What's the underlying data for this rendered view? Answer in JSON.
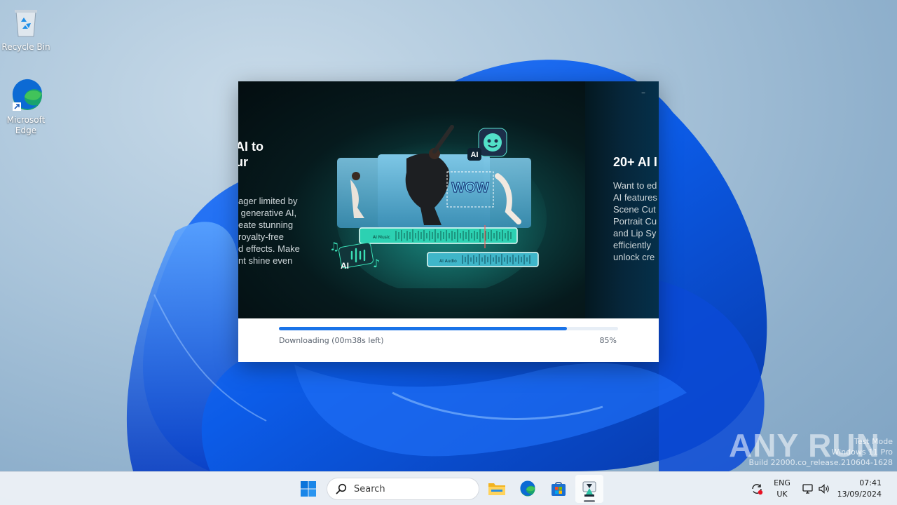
{
  "desktop": {
    "icons": [
      {
        "label": "Recycle Bin"
      },
      {
        "label": "Microsoft Edge"
      }
    ]
  },
  "installer": {
    "slide_left": {
      "title": "AI to\nur",
      "desc": "ager limited by\n generative AI,\neate stunning\nroyalty-free\nd effects. Make\nnt shine even"
    },
    "slide_right": {
      "title": "20+ AI I",
      "desc": "Want to ed\nAI features\nScene Cut\nPortrait Cu\nand Lip Sy\nefficiently\nunlock cre"
    },
    "art": {
      "wow_text": "WOW",
      "ai_badge": "AI",
      "track_music_label": "AI Music",
      "track_audio_label": "AI Audio"
    },
    "progress": {
      "status": "Downloading (00m38s left)",
      "percent_label": "85%",
      "value": 0.85
    },
    "colors": {
      "accent": "#1a73e8"
    }
  },
  "watermark": {
    "brand": "ANY RUN",
    "lines": [
      "Test Mode",
      "Windows 11 Pro",
      "Build 22000.co_release.210604-1628"
    ]
  },
  "taskbar": {
    "search_placeholder": "Search",
    "apps": [
      "start-icon",
      "file-explorer-icon",
      "edge-icon",
      "store-icon",
      "installer-icon"
    ],
    "lang_line1": "ENG",
    "lang_line2": "UK",
    "time": "07:41",
    "date": "13/09/2024"
  }
}
